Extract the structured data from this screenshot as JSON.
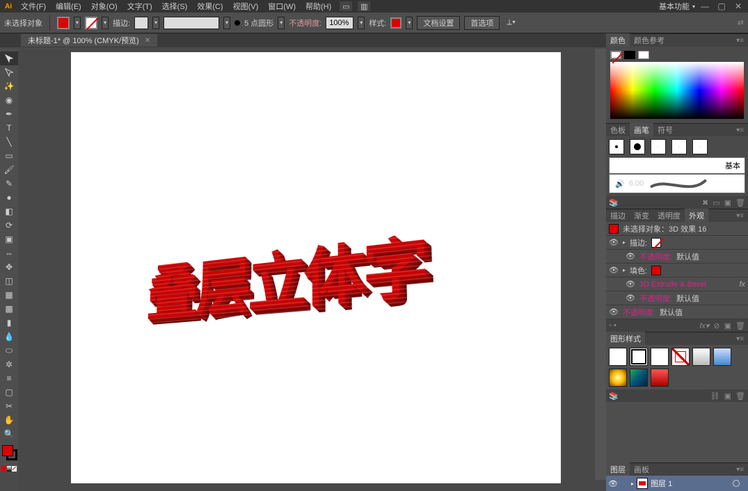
{
  "app_logo": "Ai",
  "menu": [
    "文件(F)",
    "编辑(E)",
    "对象(O)",
    "文字(T)",
    "选择(S)",
    "效果(C)",
    "视图(V)",
    "窗口(W)",
    "帮助(H)"
  ],
  "workspace_dd": "基本功能",
  "selection_status": "未选择对象",
  "opt": {
    "stroke_label": "描边:",
    "stroke_unit": "5 点圆形",
    "opacity_label": "不透明度:",
    "opacity_value": "100%",
    "style_label": "样式:",
    "doc_setup": "文档设置",
    "prefs": "首选项"
  },
  "tab_title": "未标题-1* @ 100% (CMYK/预览)",
  "artwork_text": "叠层立体字",
  "panels": {
    "color": {
      "tabs": [
        "颜色",
        "颜色参考"
      ],
      "active": 0
    },
    "brush": {
      "tabs": [
        "色板",
        "画笔",
        "符号"
      ],
      "active": 1,
      "basic": "基本",
      "size": "6.00"
    },
    "appearance": {
      "tabs": [
        "描边",
        "渐变",
        "透明度",
        "外观"
      ],
      "active": 3,
      "title": "未选择对象：3D 效果 16",
      "rows": [
        {
          "k": "描边:",
          "sw": "none"
        },
        {
          "k": "不透明度:",
          "v": "默认值",
          "red": true,
          "indent": 1
        },
        {
          "k": "填色:",
          "sw": "red"
        },
        {
          "k": "3D Extrude & Bevel",
          "fx": true,
          "red": true,
          "indent": 1
        },
        {
          "k": "不透明度:",
          "v": "默认值",
          "red": true,
          "indent": 1
        },
        {
          "k": "不透明度:",
          "v": "默认值",
          "red": true
        }
      ]
    },
    "styles": {
      "tab": "图形样式"
    },
    "layers": {
      "tabs": [
        "图层",
        "画板"
      ],
      "active": 0,
      "row": "图层 1"
    }
  }
}
